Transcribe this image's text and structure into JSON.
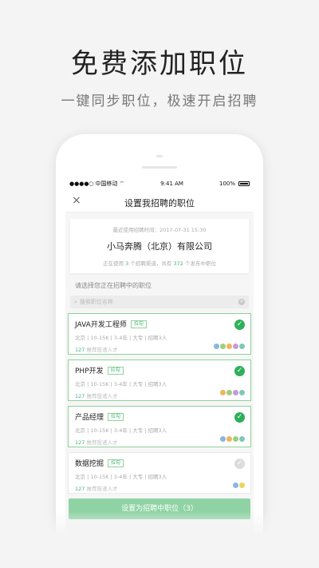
{
  "promo": {
    "headline": "免费添加职位",
    "subline": "一键同步职位，极速开启招聘"
  },
  "status_bar": {
    "signal": "●●●●○",
    "carrier": "中国移动",
    "wifi": "⌔",
    "time": "9:41 AM",
    "battery": "100%"
  },
  "nav": {
    "close_icon": "×",
    "title": "设置我招聘的职位"
  },
  "company": {
    "meta": "最近使用招聘时间：2017-07-31 15:30",
    "name": "小马奔腾（北京）有限公司",
    "stats_prefix": "正在使用",
    "stats_count": "3",
    "stats_mid": "个招聘渠道，共有",
    "stats_jobs": "372",
    "stats_suffix": "个发布中职位"
  },
  "section_label": "请选择您正在招聘中的职位",
  "search": {
    "icon": "⌕",
    "placeholder": "搜索职位名称",
    "clear_icon": "×"
  },
  "jobs": [
    {
      "title": "JAVA开发工程师",
      "tag": "拉勾",
      "requirements": "北京 | 10-15K | 3-4年 | 大专 | 招聘3人",
      "count": "127",
      "foot": "推荐投递人才",
      "selected": true,
      "check": "✓",
      "avatars": [
        "#8ab6e0",
        "#9ccf7e",
        "#f0b55a",
        "#c79ad8",
        "#7dc9b5"
      ]
    },
    {
      "title": "PHP开发",
      "tag": "拉勾",
      "requirements": "北京 | 10-15K | 3-4年 | 大专 | 招聘3人",
      "count": "127",
      "foot": "推荐投递人才",
      "selected": true,
      "check": "✓",
      "avatars": [
        "#f0b55a",
        "#9ccf7e",
        "#c79ad8",
        "#7dc9b5"
      ]
    },
    {
      "title": "产品经理",
      "tag": "拉勾",
      "requirements": "北京 | 10-15K | 3-4年 | 大专 | 招聘3人",
      "count": "127",
      "foot": "推荐投递人才",
      "selected": true,
      "check": "✓",
      "avatars": [
        "#8ab6e0",
        "#f0b55a",
        "#9ccf7e",
        "#7dc9b5"
      ]
    },
    {
      "title": "数据挖掘",
      "tag": "拉勾",
      "requirements": "北京 | 10-15K | 3-4年 | 大专 | 招聘3人",
      "count": "127",
      "foot": "推荐投递人才",
      "selected": false,
      "check": "✓",
      "avatars": [
        "#8ab6e0",
        "#f0d35a"
      ]
    }
  ],
  "submit_button": "设置为招聘中职位（3）",
  "colors": {
    "accent": "#2eb05a",
    "button": "#8fd3a4"
  }
}
